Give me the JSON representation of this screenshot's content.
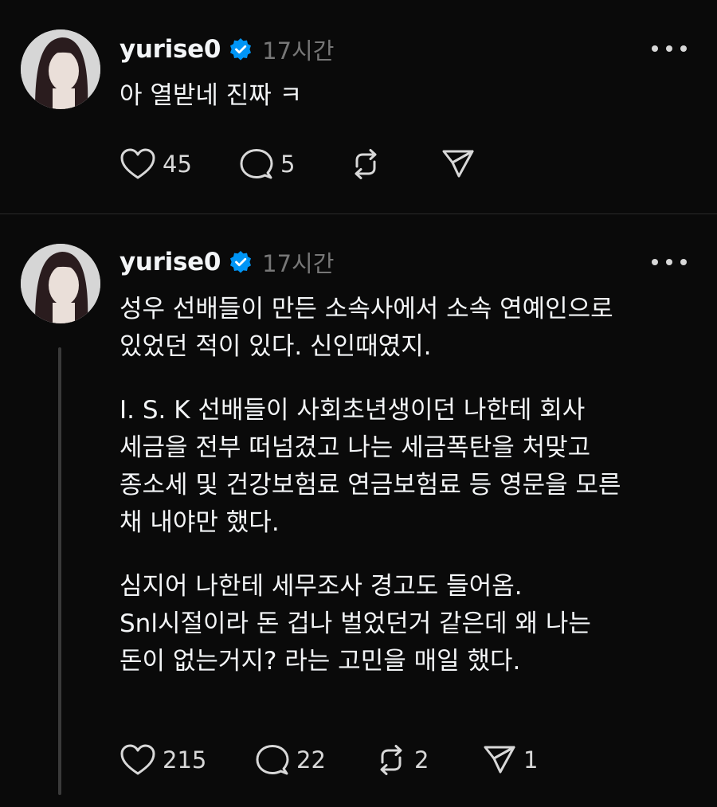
{
  "posts": [
    {
      "username": "yurise0",
      "timestamp": "17시간",
      "paragraphs": [
        "아 열받네 진짜 ㅋ"
      ],
      "actions": {
        "likes": "45",
        "replies": "5",
        "reposts": "",
        "shares": ""
      }
    },
    {
      "username": "yurise0",
      "timestamp": "17시간",
      "paragraphs": [
        "성우 선배들이 만든 소속사에서 소속 연예인으로\n있었던 적이 있다. 신인때였지.",
        "I. S. K 선배들이 사회초년생이던 나한테 회사\n세금을 전부 떠넘겼고 나는 세금폭탄을 처맞고\n종소세 및 건강보험료 연금보험료 등 영문을 모른\n채 내야만 했다.",
        "심지어 나한테 세무조사 경고도 들어옴.\nSnl시절이라 돈 겁나 벌었던거 같은데 왜 나는\n돈이 없는거지? 라는 고민을 매일 했다."
      ],
      "actions": {
        "likes": "215",
        "replies": "22",
        "reposts": "2",
        "shares": "1"
      }
    }
  ],
  "icons": {
    "verified": "verified-badge-icon",
    "more": "more-dots-icon",
    "like": "heart-icon",
    "reply": "speech-bubble-icon",
    "repost": "repost-icon",
    "share": "paper-plane-icon"
  },
  "colors": {
    "background": "#0a0a0a",
    "verified_badge": "#0095f6",
    "text_primary": "#f3f5f7",
    "text_secondary": "#777777"
  }
}
